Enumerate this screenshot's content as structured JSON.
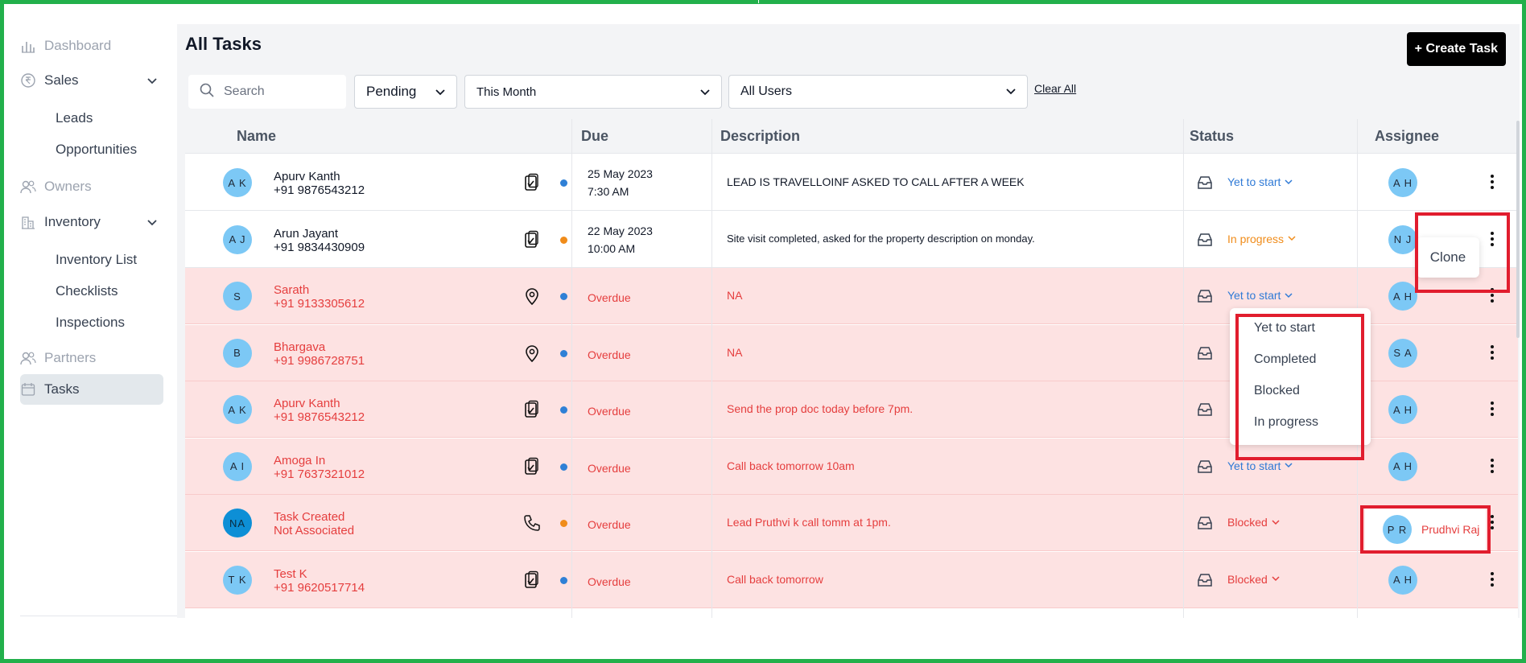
{
  "sidebar": {
    "items": [
      {
        "label": "Dashboard",
        "icon": "bar-chart-icon"
      },
      {
        "label": "Sales",
        "icon": "rupee-icon"
      },
      {
        "label": "Leads"
      },
      {
        "label": "Opportunities"
      },
      {
        "label": "Owners",
        "icon": "users-icon"
      },
      {
        "label": "Inventory",
        "icon": "building-icon"
      },
      {
        "label": "Inventory List"
      },
      {
        "label": "Checklists"
      },
      {
        "label": "Inspections"
      },
      {
        "label": "Partners",
        "icon": "users-icon"
      },
      {
        "label": "Tasks",
        "icon": "calendar-icon"
      }
    ]
  },
  "header": {
    "title": "All Tasks",
    "create_label": "+ Create Task"
  },
  "filters": {
    "search_placeholder": "Search",
    "status": "Pending",
    "period": "This Month",
    "users": "All Users",
    "clear_all": "Clear All"
  },
  "table": {
    "columns": [
      "Name",
      "Due",
      "Description",
      "Status",
      "Assignee"
    ],
    "rows": [
      {
        "initials": "A K",
        "name": "Apurv Kanth",
        "sub": "+91 9876543212",
        "type": "clipboard-icon",
        "dot": "#2f80d6",
        "due1": "25 May 2023",
        "due2": "7:30 AM",
        "desc": "LEAD IS TRAVELLOINF ASKED TO CALL AFTER A WEEK",
        "status": "Yet to start",
        "assignee": "A H",
        "overdue": false
      },
      {
        "initials": "A J",
        "name": "Arun Jayant",
        "sub": "+91 9834430909",
        "type": "clipboard-icon",
        "dot": "#f08c1a",
        "due1": "22 May 2023",
        "due2": "10:00 AM",
        "desc": "Site visit completed, asked for the property description on monday.",
        "status": "In progress",
        "assignee": "N J",
        "overdue": false
      },
      {
        "initials": "S",
        "name": "Sarath",
        "sub": "+91 9133305612",
        "type": "location-pin-icon",
        "dot": "#2f80d6",
        "due1": "Overdue",
        "due2": "",
        "desc": "NA",
        "status": "Yet to start",
        "assignee": "A H",
        "overdue": true
      },
      {
        "initials": "B",
        "name": "Bhargava",
        "sub": "+91 9986728751",
        "type": "location-pin-icon",
        "dot": "#2f80d6",
        "due1": "Overdue",
        "due2": "",
        "desc": "NA",
        "status": "",
        "assignee": "S A",
        "overdue": true
      },
      {
        "initials": "A K",
        "name": "Apurv Kanth",
        "sub": "+91 9876543212",
        "type": "clipboard-icon",
        "dot": "#2f80d6",
        "due1": "Overdue",
        "due2": "",
        "desc": "Send the prop doc today before 7pm.",
        "status": "",
        "assignee": "A H",
        "overdue": true
      },
      {
        "initials": "A I",
        "name": "Amoga In",
        "sub": "+91 7637321012",
        "type": "clipboard-icon",
        "dot": "#2f80d6",
        "due1": "Overdue",
        "due2": "",
        "desc": "Call back tomorrow 10am",
        "status": "Yet to start",
        "assignee": "A H",
        "overdue": true
      },
      {
        "initials": "NA",
        "name": "Task Created",
        "sub": "Not Associated",
        "type": "phone-icon",
        "dot": "#f08c1a",
        "due1": "Overdue",
        "due2": "",
        "desc": "Lead Pruthvi k call tomm at 1pm.",
        "status": "Blocked",
        "assignee": "P R",
        "overdue": true
      },
      {
        "initials": "T K",
        "name": "Test K",
        "sub": "+91 9620517714",
        "type": "clipboard-icon",
        "dot": "#2f80d6",
        "due1": "Overdue",
        "due2": "",
        "desc": "Call back tomorrow",
        "status": "Blocked",
        "assignee": "A H",
        "overdue": true
      }
    ]
  },
  "status_menu": {
    "options": [
      "Yet to start",
      "Completed",
      "Blocked",
      "In progress"
    ]
  },
  "row_menu": {
    "clone_label": "Clone"
  },
  "assignee_popup": {
    "initials": "P R",
    "name": "Prudhvi Raj"
  },
  "colors": {
    "yet_to_start": "#2f7ad6",
    "in_progress": "#f08c1a",
    "blocked": "#e53e3e",
    "overdue_bg": "#fde2e2",
    "highlight": "#e11d2e",
    "frame": "#22b04b"
  }
}
